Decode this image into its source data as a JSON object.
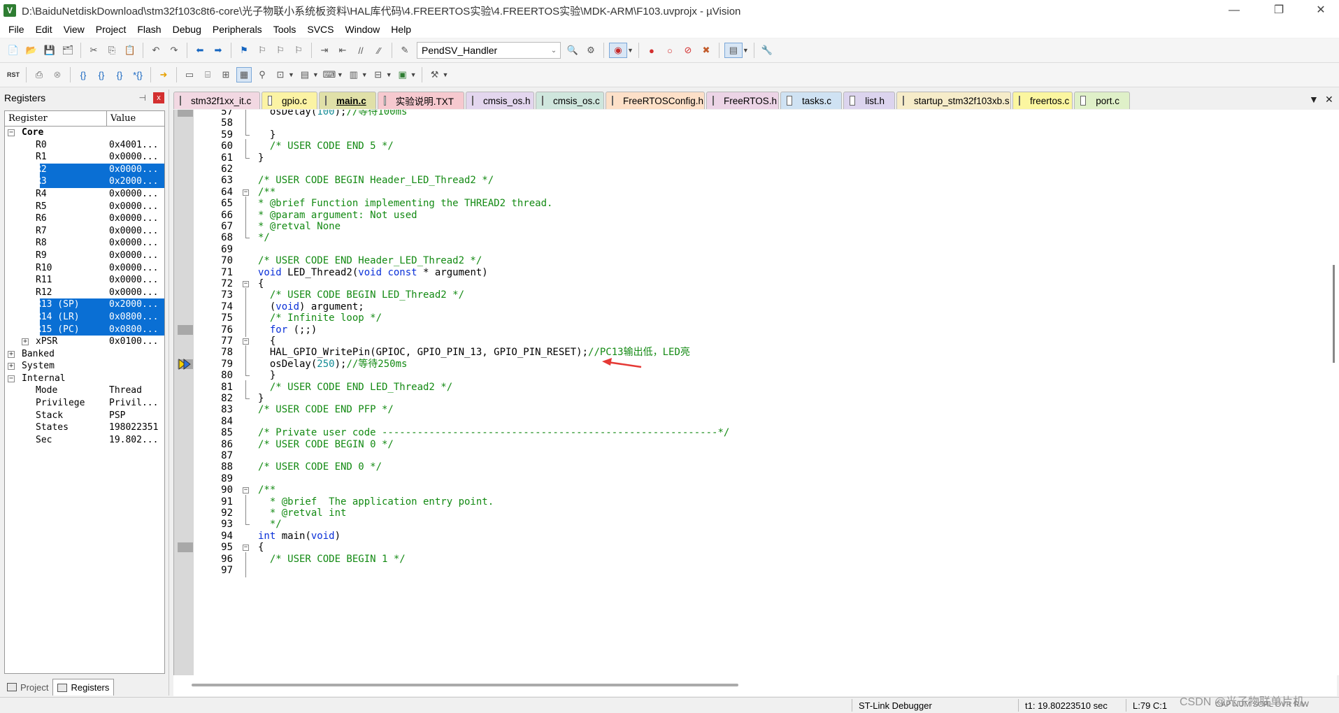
{
  "window": {
    "title": "D:\\BaiduNetdiskDownload\\stm32f103c8t6-core\\光子物联小系统板资料\\HAL库代码\\4.FREERTOS实验\\4.FREERTOS实验\\MDK-ARM\\F103.uvprojx - µVision",
    "app_icon": "V",
    "minimize": "—",
    "restore": "❐",
    "close": "✕"
  },
  "menu": [
    "File",
    "Edit",
    "View",
    "Project",
    "Flash",
    "Debug",
    "Peripherals",
    "Tools",
    "SVCS",
    "Window",
    "Help"
  ],
  "toolbar": {
    "function_combo": "PendSV_Handler",
    "rst_label": "RST"
  },
  "registers": {
    "title": "Registers",
    "pin_icon": "📌",
    "close_icon": "x",
    "col_register": "Register",
    "col_value": "Value",
    "rows": [
      {
        "name": "Core",
        "value": "",
        "level": 0,
        "toggle": "−",
        "bold": true,
        "selected": false
      },
      {
        "name": "R0",
        "value": "0x4001...",
        "level": 2,
        "toggle": "",
        "bold": false,
        "selected": false
      },
      {
        "name": "R1",
        "value": "0x0000...",
        "level": 2,
        "toggle": "",
        "bold": false,
        "selected": false
      },
      {
        "name": "R2",
        "value": "0x0000...",
        "level": 2,
        "toggle": "",
        "bold": false,
        "selected": true
      },
      {
        "name": "R3",
        "value": "0x2000...",
        "level": 2,
        "toggle": "",
        "bold": false,
        "selected": true
      },
      {
        "name": "R4",
        "value": "0x0000...",
        "level": 2,
        "toggle": "",
        "bold": false,
        "selected": false
      },
      {
        "name": "R5",
        "value": "0x0000...",
        "level": 2,
        "toggle": "",
        "bold": false,
        "selected": false
      },
      {
        "name": "R6",
        "value": "0x0000...",
        "level": 2,
        "toggle": "",
        "bold": false,
        "selected": false
      },
      {
        "name": "R7",
        "value": "0x0000...",
        "level": 2,
        "toggle": "",
        "bold": false,
        "selected": false
      },
      {
        "name": "R8",
        "value": "0x0000...",
        "level": 2,
        "toggle": "",
        "bold": false,
        "selected": false
      },
      {
        "name": "R9",
        "value": "0x0000...",
        "level": 2,
        "toggle": "",
        "bold": false,
        "selected": false
      },
      {
        "name": "R10",
        "value": "0x0000...",
        "level": 2,
        "toggle": "",
        "bold": false,
        "selected": false
      },
      {
        "name": "R11",
        "value": "0x0000...",
        "level": 2,
        "toggle": "",
        "bold": false,
        "selected": false
      },
      {
        "name": "R12",
        "value": "0x0000...",
        "level": 2,
        "toggle": "",
        "bold": false,
        "selected": false
      },
      {
        "name": "R13 (SP)",
        "value": "0x2000...",
        "level": 2,
        "toggle": "",
        "bold": false,
        "selected": true
      },
      {
        "name": "R14 (LR)",
        "value": "0x0800...",
        "level": 2,
        "toggle": "",
        "bold": false,
        "selected": true
      },
      {
        "name": "R15 (PC)",
        "value": "0x0800...",
        "level": 2,
        "toggle": "",
        "bold": false,
        "selected": true
      },
      {
        "name": "xPSR",
        "value": "0x0100...",
        "level": 1,
        "toggle": "+",
        "bold": false,
        "selected": false
      },
      {
        "name": "Banked",
        "value": "",
        "level": 0,
        "toggle": "+",
        "bold": false,
        "selected": false
      },
      {
        "name": "System",
        "value": "",
        "level": 0,
        "toggle": "+",
        "bold": false,
        "selected": false
      },
      {
        "name": "Internal",
        "value": "",
        "level": 0,
        "toggle": "−",
        "bold": false,
        "selected": false
      },
      {
        "name": "Mode",
        "value": "Thread",
        "level": 2,
        "toggle": "",
        "bold": false,
        "selected": false
      },
      {
        "name": "Privilege",
        "value": "Privil...",
        "level": 2,
        "toggle": "",
        "bold": false,
        "selected": false
      },
      {
        "name": "Stack",
        "value": "PSP",
        "level": 2,
        "toggle": "",
        "bold": false,
        "selected": false
      },
      {
        "name": "States",
        "value": "198022351",
        "level": 2,
        "toggle": "",
        "bold": false,
        "selected": false
      },
      {
        "name": "Sec",
        "value": "19.802...",
        "level": 2,
        "toggle": "",
        "bold": false,
        "selected": false
      }
    ],
    "tabs": [
      {
        "label": "Project",
        "active": false
      },
      {
        "label": "Registers",
        "active": true
      }
    ]
  },
  "editor_tabs": [
    {
      "label": "stm32f1xx_it.c",
      "color": "#f2d8e2",
      "active": false
    },
    {
      "label": "gpio.c",
      "color": "#fbf3a4",
      "active": false
    },
    {
      "label": "main.c",
      "color": "#e0e0a8",
      "active": true
    },
    {
      "label": "实验说明.TXT",
      "color": "#f6c9cf",
      "active": false
    },
    {
      "label": "cmsis_os.h",
      "color": "#e3d6ee",
      "active": false
    },
    {
      "label": "cmsis_os.c",
      "color": "#cfe6dd",
      "active": false
    },
    {
      "label": "FreeRTOSConfig.h",
      "color": "#fde0c8",
      "active": false
    },
    {
      "label": "FreeRTOS.h",
      "color": "#ecd4e6",
      "active": false
    },
    {
      "label": "tasks.c",
      "color": "#cfe2f3",
      "active": false
    },
    {
      "label": "list.h",
      "color": "#dcd4ee",
      "active": false
    },
    {
      "label": "startup_stm32f103xb.s",
      "color": "#f6ecc9",
      "active": false
    },
    {
      "label": "freertos.c",
      "color": "#fbf6a0",
      "active": false
    },
    {
      "label": "port.c",
      "color": "#dff0c8",
      "active": false
    }
  ],
  "editor_controls": {
    "dropdown": "▼",
    "close": "✕"
  },
  "code_lines": [
    {
      "n": "57",
      "fold": "line",
      "parts": [
        [
          "",
          "  osDelay("
        ],
        [
          "nb",
          "100"
        ],
        [
          "",
          ");"
        ],
        [
          "cm",
          "//等待100ms"
        ]
      ]
    },
    {
      "n": "58",
      "fold": "line",
      "parts": []
    },
    {
      "n": "59",
      "fold": "end",
      "parts": [
        [
          "",
          "  }"
        ]
      ]
    },
    {
      "n": "60",
      "fold": "line",
      "parts": [
        [
          "cm",
          "  /* USER CODE END 5 */"
        ]
      ]
    },
    {
      "n": "61",
      "fold": "end",
      "parts": [
        [
          "",
          "}"
        ]
      ]
    },
    {
      "n": "62",
      "fold": "",
      "parts": []
    },
    {
      "n": "63",
      "fold": "",
      "parts": [
        [
          "cm",
          "/* USER CODE BEGIN Header_LED_Thread2 */"
        ]
      ]
    },
    {
      "n": "64",
      "fold": "box",
      "parts": [
        [
          "cm",
          "/**"
        ]
      ]
    },
    {
      "n": "65",
      "fold": "line",
      "parts": [
        [
          "cm",
          "* @brief Function implementing the THREAD2 thread."
        ]
      ]
    },
    {
      "n": "66",
      "fold": "line",
      "parts": [
        [
          "cm",
          "* @param argument: Not used"
        ]
      ]
    },
    {
      "n": "67",
      "fold": "line",
      "parts": [
        [
          "cm",
          "* @retval None"
        ]
      ]
    },
    {
      "n": "68",
      "fold": "end",
      "parts": [
        [
          "cm",
          "*/"
        ]
      ]
    },
    {
      "n": "69",
      "fold": "",
      "parts": []
    },
    {
      "n": "70",
      "fold": "",
      "parts": [
        [
          "cm",
          "/* USER CODE END Header_LED_Thread2 */"
        ]
      ]
    },
    {
      "n": "71",
      "fold": "",
      "parts": [
        [
          "kw",
          "void"
        ],
        [
          "",
          " LED_Thread2("
        ],
        [
          "kw",
          "void const"
        ],
        [
          "",
          " * argument)"
        ]
      ]
    },
    {
      "n": "72",
      "fold": "box",
      "parts": [
        [
          "",
          "{"
        ]
      ]
    },
    {
      "n": "73",
      "fold": "line",
      "parts": [
        [
          "cm",
          "  /* USER CODE BEGIN LED_Thread2 */"
        ]
      ]
    },
    {
      "n": "74",
      "fold": "line",
      "parts": [
        [
          "",
          "  ("
        ],
        [
          "kw",
          "void"
        ],
        [
          "",
          ") argument;"
        ]
      ]
    },
    {
      "n": "75",
      "fold": "line",
      "parts": [
        [
          "cm",
          "  /* Infinite loop */"
        ]
      ]
    },
    {
      "n": "76",
      "fold": "line",
      "parts": [
        [
          "kw",
          "  for"
        ],
        [
          "",
          " (;;)"
        ]
      ]
    },
    {
      "n": "77",
      "fold": "box",
      "parts": [
        [
          "",
          "  {"
        ]
      ]
    },
    {
      "n": "78",
      "fold": "line",
      "parts": [
        [
          "",
          "  HAL_GPIO_WritePin(GPIOC, GPIO_PIN_13, GPIO_PIN_RESET);"
        ],
        [
          "cm",
          "//PC13输出低，LED亮"
        ]
      ]
    },
    {
      "n": "79",
      "fold": "line",
      "parts": [
        [
          "",
          "  osDelay("
        ],
        [
          "nb",
          "250"
        ],
        [
          "",
          ");"
        ],
        [
          "cm",
          "//等待250ms"
        ]
      ]
    },
    {
      "n": "80",
      "fold": "end",
      "parts": [
        [
          "",
          "  }"
        ]
      ]
    },
    {
      "n": "81",
      "fold": "line",
      "parts": [
        [
          "cm",
          "  /* USER CODE END LED_Thread2 */"
        ]
      ]
    },
    {
      "n": "82",
      "fold": "end",
      "parts": [
        [
          "",
          "}"
        ]
      ]
    },
    {
      "n": "83",
      "fold": "",
      "parts": [
        [
          "cm",
          "/* USER CODE END PFP */"
        ]
      ]
    },
    {
      "n": "84",
      "fold": "",
      "parts": []
    },
    {
      "n": "85",
      "fold": "",
      "parts": [
        [
          "cm",
          "/* Private user code ---------------------------------------------------------*/"
        ]
      ]
    },
    {
      "n": "86",
      "fold": "",
      "parts": [
        [
          "cm",
          "/* USER CODE BEGIN 0 */"
        ]
      ]
    },
    {
      "n": "87",
      "fold": "",
      "parts": []
    },
    {
      "n": "88",
      "fold": "",
      "parts": [
        [
          "cm",
          "/* USER CODE END 0 */"
        ]
      ]
    },
    {
      "n": "89",
      "fold": "",
      "parts": []
    },
    {
      "n": "90",
      "fold": "box",
      "parts": [
        [
          "cm",
          "/**"
        ]
      ]
    },
    {
      "n": "91",
      "fold": "line",
      "parts": [
        [
          "cm",
          "  * @brief  The application entry point."
        ]
      ]
    },
    {
      "n": "92",
      "fold": "line",
      "parts": [
        [
          "cm",
          "  * @retval int"
        ]
      ]
    },
    {
      "n": "93",
      "fold": "end",
      "parts": [
        [
          "cm",
          "  */"
        ]
      ]
    },
    {
      "n": "94",
      "fold": "",
      "parts": [
        [
          "kw",
          "int"
        ],
        [
          "",
          " main("
        ],
        [
          "kw",
          "void"
        ],
        [
          "",
          ")"
        ]
      ]
    },
    {
      "n": "95",
      "fold": "box",
      "parts": [
        [
          "",
          "{"
        ]
      ]
    },
    {
      "n": "96",
      "fold": "line",
      "parts": [
        [
          "cm",
          "  /* USER CODE BEGIN 1 */"
        ]
      ]
    },
    {
      "n": "97",
      "fold": "line",
      "parts": []
    }
  ],
  "gutter_marks": [
    "57",
    "76",
    "79",
    "95"
  ],
  "exec_line": "79",
  "status": {
    "debugger": "ST-Link Debugger",
    "time": "t1: 19.80223510 sec",
    "position": "L:79 C:1",
    "flags": "CAP NUM SCRL OVR R/W"
  },
  "watermark": "CSDN @光子物联单片机",
  "colors": {
    "selection": "#0a6fd4",
    "comment": "#138a13",
    "keyword": "#0a30d8",
    "number": "#148c96",
    "annotation_arrow": "#e53935"
  }
}
